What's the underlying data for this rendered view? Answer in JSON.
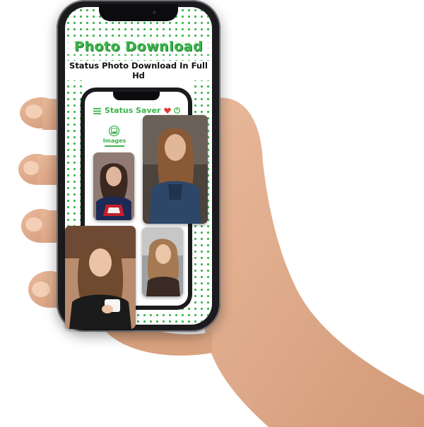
{
  "promo": {
    "title": "Photo Download",
    "subtitle": "Status Photo Download In Full Hd"
  },
  "app": {
    "title": "Status Saver",
    "tab_label": "Images"
  },
  "icons": {
    "menu": "hamburger-menu-icon",
    "favorite": "heart-icon",
    "power": "power-icon",
    "images_tab": "image-icon"
  },
  "colors": {
    "accent": "#3bb44b",
    "heart": "#e53935",
    "phone_frame": "#1b1b1d"
  },
  "gallery": {
    "photos": [
      "photo-1",
      "photo-2",
      "photo-3",
      "photo-4"
    ]
  }
}
